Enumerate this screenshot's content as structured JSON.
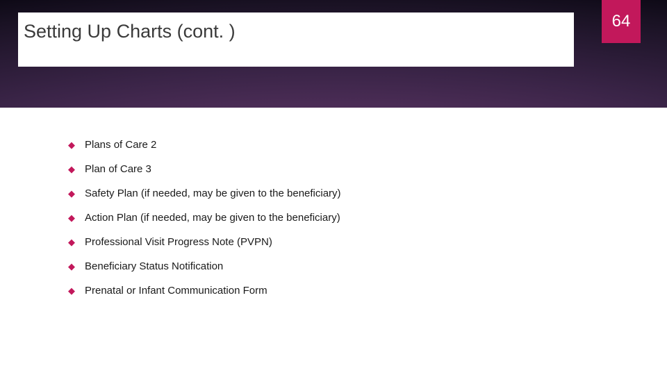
{
  "slide": {
    "title": "Setting Up Charts (cont. )",
    "page_number": "64",
    "bullets": [
      "Plans of Care 2",
      "Plan of Care 3",
      "Safety Plan (if needed, may be given to the beneficiary)",
      "Action Plan (if needed, may be given to the beneficiary)",
      "Professional Visit Progress Note (PVPN)",
      "Beneficiary Status Notification",
      "Prenatal or Infant Communication Form"
    ]
  }
}
